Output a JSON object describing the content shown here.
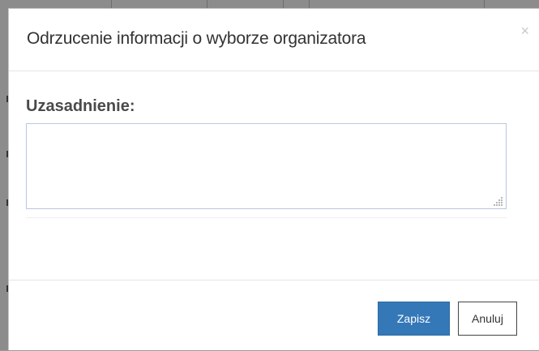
{
  "modal": {
    "title": "Odrzucenie informacji o wyborze organizatora",
    "close_glyph": "×",
    "close_icon": "close-icon"
  },
  "form": {
    "label": "Uzasadnienie:",
    "textarea_value": "",
    "textarea_placeholder": ""
  },
  "footer": {
    "save_label": "Zapisz",
    "cancel_label": "Anuluj"
  },
  "colors": {
    "primary": "#3478b7",
    "border_focus": "#b9c7dd"
  }
}
